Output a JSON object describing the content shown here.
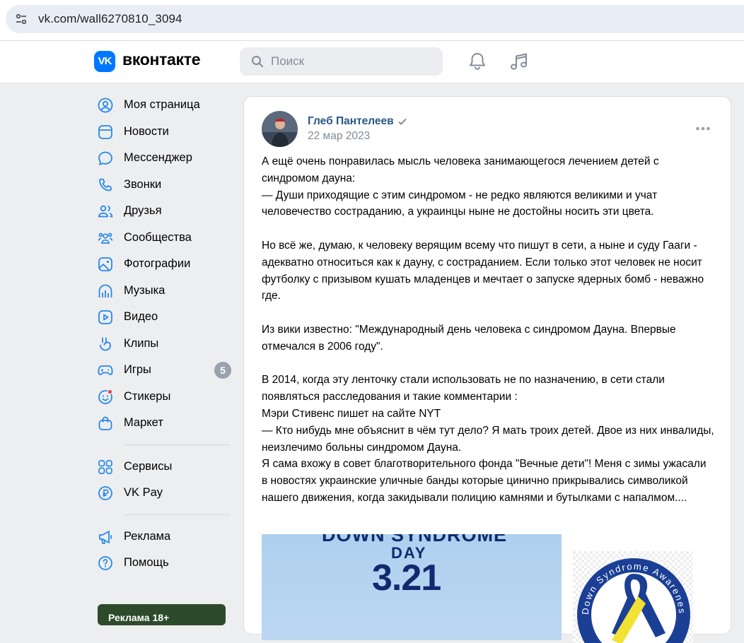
{
  "browser": {
    "url": "vk.com/wall6270810_3094"
  },
  "header": {
    "logo_mark": "VK",
    "logo_text": "вконтакте",
    "search_placeholder": "Поиск"
  },
  "sidebar": {
    "items": [
      {
        "label": "Моя страница",
        "icon": "user-circle-icon"
      },
      {
        "label": "Новости",
        "icon": "news-icon"
      },
      {
        "label": "Мессенджер",
        "icon": "message-icon"
      },
      {
        "label": "Звонки",
        "icon": "phone-icon"
      },
      {
        "label": "Друзья",
        "icon": "friends-icon"
      },
      {
        "label": "Сообщества",
        "icon": "communities-icon"
      },
      {
        "label": "Фотографии",
        "icon": "photo-icon"
      },
      {
        "label": "Музыка",
        "icon": "music-icon"
      },
      {
        "label": "Видео",
        "icon": "video-icon"
      },
      {
        "label": "Клипы",
        "icon": "clips-icon"
      },
      {
        "label": "Игры",
        "icon": "games-icon",
        "badge": "5"
      },
      {
        "label": "Стикеры",
        "icon": "sticker-icon"
      },
      {
        "label": "Маркет",
        "icon": "market-icon"
      }
    ],
    "items2": [
      {
        "label": "Сервисы",
        "icon": "services-icon"
      },
      {
        "label": "VK Pay",
        "icon": "vkpay-icon"
      }
    ],
    "items3": [
      {
        "label": "Реклама",
        "icon": "megaphone-icon"
      },
      {
        "label": "Помощь",
        "icon": "help-icon"
      }
    ],
    "ad_label": "Реклама 18+"
  },
  "post": {
    "author": "Глеб Пантелеев",
    "date": "22 мар 2023",
    "paragraphs": [
      [
        "А ещё очень понравилась мысль человека занимающегося лечением детей с синдромом дауна:",
        "— Души приходящие с этим синдромом - не редко являются великими и учат человечество состраданию, а украинцы ныне не достойны носить эти цвета."
      ],
      [
        "Но всё же, думаю, к человеку верящим всему что пишут в сети, а ныне и суду Гааги - адекватно относиться как к дауну, с состраданием. Если только этот человек не носит футболку с призывом кушать младенцев и мечтает о запуске ядерных бомб - неважно где."
      ],
      [
        "Из вики известно: \"Международный день человека с синдромом Дауна. Впервые отмечался в 2006 году\"."
      ],
      [
        "В 2014, когда эту ленточку стали использовать не по назначению, в сети стали появляться расследования и такие комментарии :",
        "Мэри Стивенс пишет на сайте NYT",
        "— Кто нибудь мне объяснит в чём тут дело? Я мать троих детей. Двое из них инвалиды, неизлечимо больны синдромом Дауна.",
        "Я сама вхожу в совет благотворительного фонда \"Вечные дети\"! Меня с зимы ужасали в новостях украинские уличные банды которые цинично прикрывались символикой нашего движения, когда закидывали полицию камнями и бутылками с напалмом...."
      ]
    ],
    "image1": {
      "line1": "DOWN SYNDROME",
      "line2": "DAY",
      "line3": "3.21"
    },
    "image2": {
      "ring_text": "Down Syndrome Awareness"
    }
  }
}
